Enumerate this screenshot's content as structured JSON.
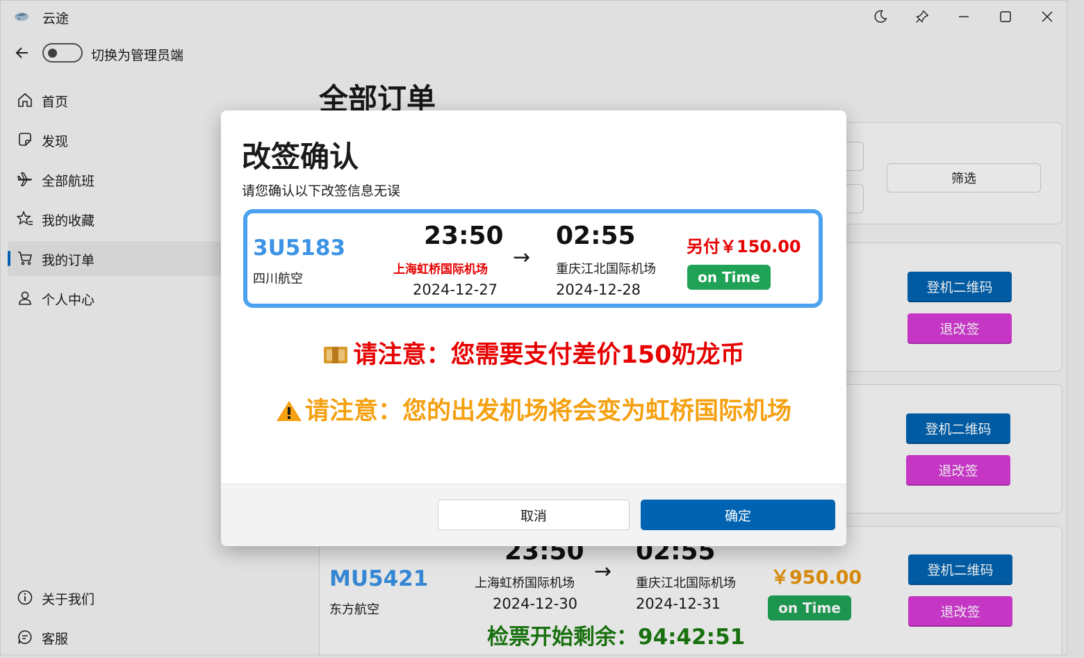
{
  "app": {
    "title": "云途",
    "admin_toggle_label": "切换为管理员端"
  },
  "nav": {
    "items": [
      {
        "label": "首页",
        "icon": "home-icon"
      },
      {
        "label": "发现",
        "icon": "note-icon"
      },
      {
        "label": "全部航班",
        "icon": "airplane-icon"
      },
      {
        "label": "我的收藏",
        "icon": "star-list-icon"
      },
      {
        "label": "我的订单",
        "icon": "cart-icon",
        "selected": true
      },
      {
        "label": "个人中心",
        "icon": "person-icon"
      }
    ],
    "footer_items": [
      {
        "label": "关于我们",
        "icon": "info-icon"
      },
      {
        "label": "客服",
        "icon": "chat-icon"
      }
    ]
  },
  "page": {
    "title": "全部订单",
    "filter_label": "筛选"
  },
  "orders": {
    "boarding_label": "登机二维码",
    "refund_label": "退改签",
    "visible_order": {
      "flight_no": "MU5421",
      "airline": "东方航空",
      "dep_time": "23:50",
      "dep_airport": "上海虹桥国际机场",
      "dep_date": "2024-12-30",
      "arrow": "→",
      "arr_time": "02:55",
      "arr_airport": "重庆江北国际机场",
      "arr_date": "2024-12-31",
      "price": "￥950.00",
      "status": "on Time",
      "countdown": "检票开始剩余：94:42:51"
    }
  },
  "dialog": {
    "title": "改签确认",
    "subtitle": "请您确认以下改签信息无误",
    "flight_no": "3U5183",
    "airline": "四川航空",
    "dep_time": "23:50",
    "dep_airport": "上海虹桥国际机场",
    "dep_date": "2024-12-27",
    "arrow": "→",
    "arr_time": "02:55",
    "arr_airport": "重庆江北国际机场",
    "arr_date": "2024-12-28",
    "extra_fee": "另付￥150.00",
    "status": "on Time",
    "notice_payment": "请注意：您需要支付差价150奶龙币",
    "notice_airport": "请注意：您的出发机场将会变为虹桥国际机场",
    "cancel_label": "取消",
    "confirm_label": "确定"
  },
  "colors": {
    "accent": "#0063b1",
    "flight_no": "#3a93e5",
    "status_green": "#1fa256",
    "refund_purple": "#d63bd6",
    "fee_red": "#e60000",
    "warning_orange": "#f5a010",
    "price_orange": "#e8940a",
    "countdown_green": "#1b7a10"
  }
}
